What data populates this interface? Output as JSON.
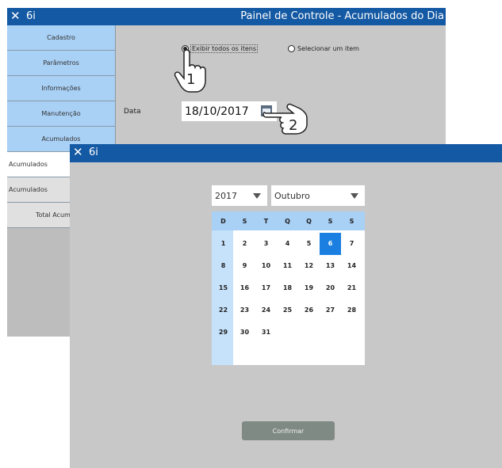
{
  "back_window": {
    "close_glyph": "✕",
    "app_name": "6i",
    "title": "Painel de Controle - Acumulados do Dia",
    "sidebar": [
      "Cadastro",
      "Parâmetros",
      "Informações",
      "Manutenção",
      "Acumulados",
      "Acumulados",
      "Acumulados",
      "Total Acum"
    ],
    "radio_all": "Exibir todos os itens",
    "radio_one": "Selecionar um item",
    "date_label": "Data",
    "date_value": "18/10/2017",
    "hand1_number": "1",
    "hand2_number": "2"
  },
  "front_window": {
    "close_glyph": "✕",
    "app_name": "6i",
    "year": "2017",
    "month": "Outubro",
    "weekdays": [
      "D",
      "S",
      "T",
      "Q",
      "Q",
      "S",
      "S"
    ],
    "days": [
      "1",
      "2",
      "3",
      "4",
      "5",
      "6",
      "7",
      "8",
      "9",
      "10",
      "11",
      "12",
      "13",
      "14",
      "15",
      "16",
      "17",
      "18",
      "19",
      "20",
      "21",
      "22",
      "23",
      "24",
      "25",
      "26",
      "27",
      "28",
      "29",
      "30",
      "31"
    ],
    "selected_day": "6",
    "confirm_label": "Confirmar"
  }
}
